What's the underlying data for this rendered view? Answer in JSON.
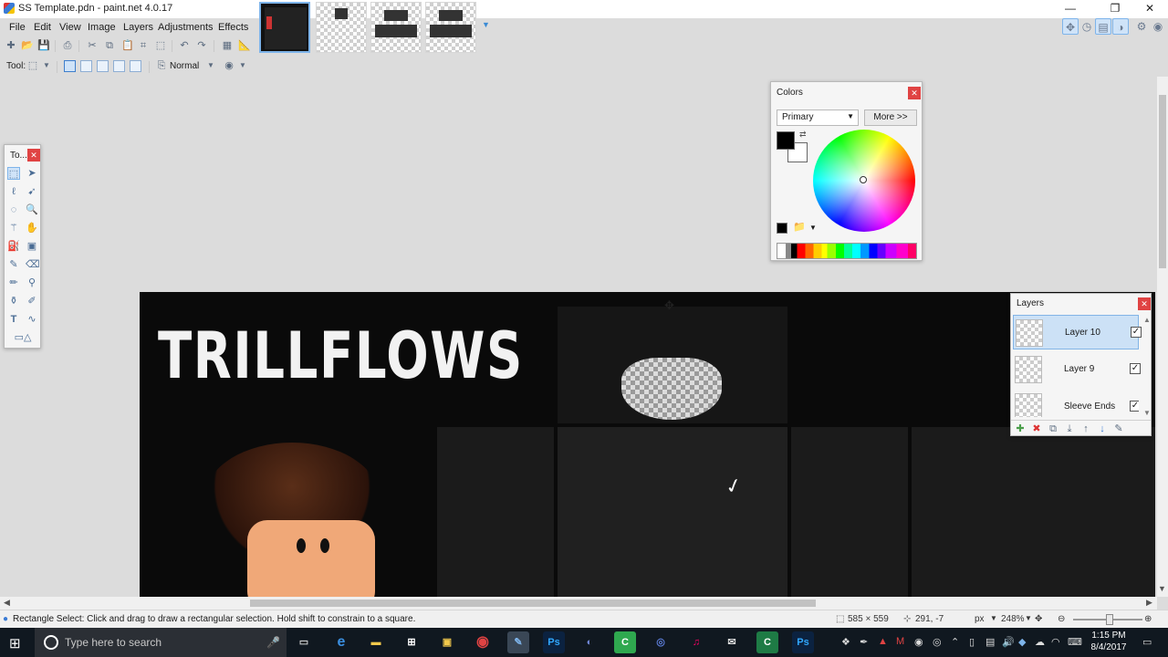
{
  "window": {
    "title": "SS Template.pdn - paint.net 4.0.17"
  },
  "menu": [
    "File",
    "Edit",
    "View",
    "Image",
    "Layers",
    "Adjustments",
    "Effects"
  ],
  "toolbar": {
    "tool_label": "Tool:",
    "blend_mode": "Normal"
  },
  "canvas": {
    "artwork_text": "TRILLFLOWS"
  },
  "tools_window": {
    "title": "To..."
  },
  "colors_window": {
    "title": "Colors",
    "selector": "Primary",
    "more_button": "More >>",
    "primary_color": "#000000",
    "secondary_color": "#ffffff"
  },
  "layers_window": {
    "title": "Layers",
    "layers": [
      {
        "name": "Layer 10",
        "visible": true,
        "selected": true
      },
      {
        "name": "Layer 9",
        "visible": true,
        "selected": false
      },
      {
        "name": "Sleeve Ends",
        "visible": true,
        "selected": false
      }
    ]
  },
  "status": {
    "hint": "Rectangle Select: Click and drag to draw a rectangular selection. Hold shift to constrain to a square.",
    "image_size": "585 × 559",
    "cursor_pos": "291, -7",
    "units": "px",
    "zoom": "248%"
  },
  "taskbar": {
    "search_placeholder": "Type here to search",
    "time": "1:15 PM",
    "date": "8/4/2017"
  },
  "colors": {
    "accent": "#7eb4ea",
    "close_red": "#e04343",
    "taskbar": "#101820"
  }
}
